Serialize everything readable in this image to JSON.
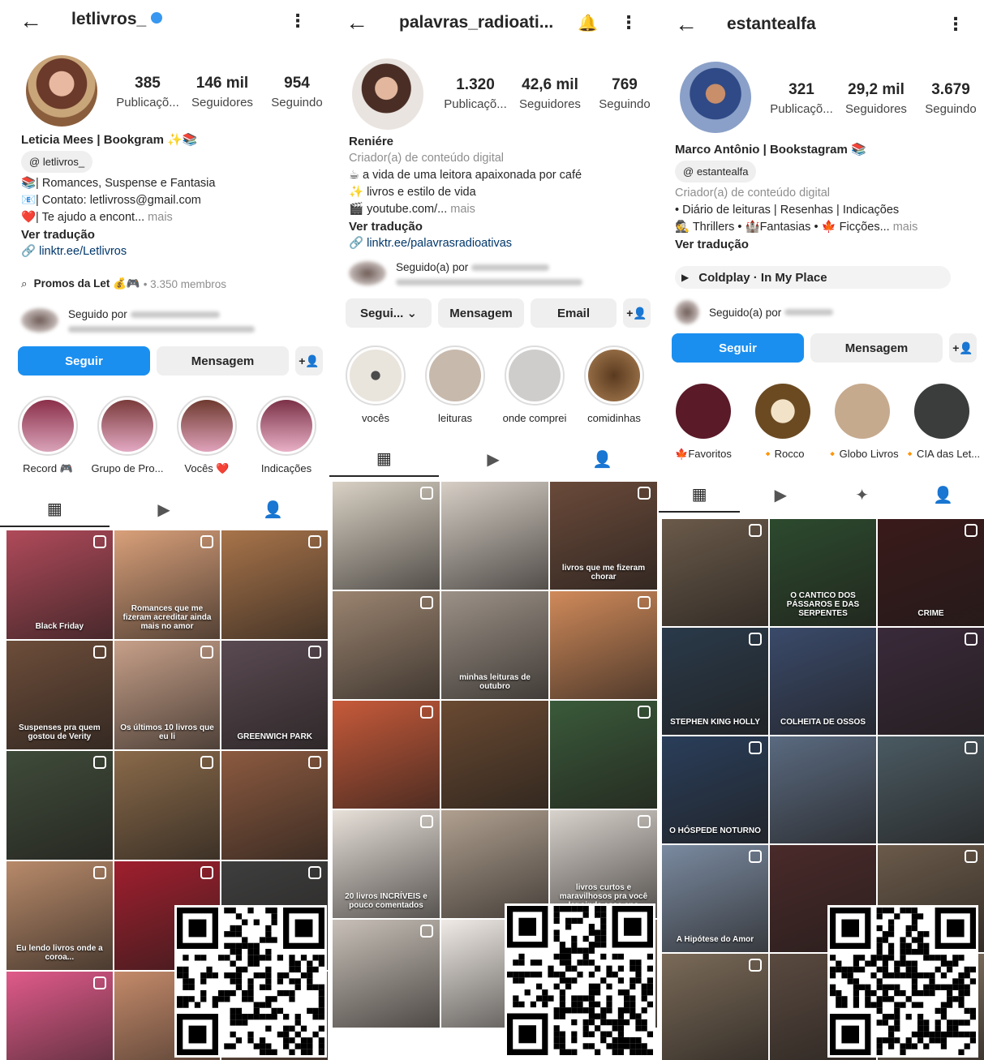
{
  "profiles": [
    {
      "username": "letlivros_",
      "verified": true,
      "stats": [
        {
          "num": "385",
          "label": "Publicaçõ..."
        },
        {
          "num": "146 mil",
          "label": "Seguidores"
        },
        {
          "num": "954",
          "label": "Seguindo"
        }
      ],
      "name": "Leticia Mees | Bookgram ✨📚",
      "threads": "letlivros_",
      "bio": [
        "📚| Romances, Suspense e Fantasia",
        "📧| Contato: letlivross@gmail.com",
        "❤️| Te ajudo a encont..."
      ],
      "more": " mais",
      "translate": "Ver tradução",
      "link": "linktr.ee/Letlivros",
      "channel": {
        "name": "Promos da Let 💰🎮",
        "members": "• 3.350 membros"
      },
      "followed_by": "Seguido por",
      "buttons": [
        "Seguir",
        "Mensagem"
      ],
      "highlights": [
        "Record 🎮",
        "Grupo de Pro...",
        "Vocês ❤️",
        "Indicações"
      ],
      "grid_captions": [
        "Black Friday",
        "Romances que me fizeram acreditar ainda mais no amor",
        "",
        "Suspenses pra quem gostou de Verity",
        "Os últimos 10 livros que eu li",
        "GREENWICH PARK",
        "",
        "",
        "",
        "Eu lendo livros onde a coroa...",
        "",
        ""
      ]
    },
    {
      "username": "palavras_radioati...",
      "stats": [
        {
          "num": "1.320",
          "label": "Publicaçõ..."
        },
        {
          "num": "42,6 mil",
          "label": "Seguidores"
        },
        {
          "num": "769",
          "label": "Seguindo"
        }
      ],
      "name": "Reniére",
      "category": "Criador(a) de conteúdo digital",
      "bio": [
        "☕ a vida de uma leitora apaixonada por café",
        "✨ livros e estilo de vida",
        "🎬 youtube.com/..."
      ],
      "more": " mais",
      "translate": "Ver tradução",
      "link": "linktr.ee/palavrasradioativas",
      "followed_by": "Seguido(a) por",
      "buttons": [
        "Segui... ⌄",
        "Mensagem",
        "Email"
      ],
      "highlights": [
        "vocês",
        "leituras",
        "onde comprei",
        "comidinhas"
      ],
      "grid_captions": [
        "",
        "",
        "livros que me fizeram chorar",
        "",
        "minhas leituras de outubro",
        "",
        "",
        "",
        "",
        "20 livros INCRÍVEIS e pouco comentados",
        "",
        "livros curtos e maravilhosos pra você ler ainda esse ano"
      ]
    },
    {
      "username": "estantealfa",
      "stats": [
        {
          "num": "321",
          "label": "Publicaçõ..."
        },
        {
          "num": "29,2 mil",
          "label": "Seguidores"
        },
        {
          "num": "3.679",
          "label": "Seguindo"
        }
      ],
      "name": "Marco Antônio | Bookstagram 📚",
      "threads": "estantealfa",
      "category": "Criador(a) de conteúdo digital",
      "bio": [
        "• Diário de leituras | Resenhas | Indicações",
        "🕵 Thrillers • 🏰Fantasias • 🍁 Ficções..."
      ],
      "more": " mais",
      "translate": "Ver tradução",
      "music": "Coldplay · In My Place",
      "followed_by": "Seguido(a) por",
      "buttons": [
        "Seguir",
        "Mensagem"
      ],
      "highlights": [
        "🍁Favoritos",
        "🔸Rocco",
        "🔸Globo Livros",
        "🔸CIA das Let..."
      ],
      "grid_captions": [
        "",
        "O CANTICO DOS PÁSSAROS E DAS SERPENTES",
        "CRIME",
        "STEPHEN KING HOLLY",
        "COLHEITA DE OSSOS",
        "",
        "O HÓSPEDE NOTURNO",
        "",
        "",
        "A Hipótese do Amor",
        "",
        ""
      ]
    }
  ],
  "colors": {
    "accent": "#1a8ff0",
    "link": "#00376b"
  },
  "icons": [
    "back-arrow-icon",
    "more-vert-icon",
    "bell-icon",
    "grid-icon",
    "reels-icon",
    "tagged-icon",
    "add-person-icon",
    "threads-icon",
    "play-icon"
  ]
}
